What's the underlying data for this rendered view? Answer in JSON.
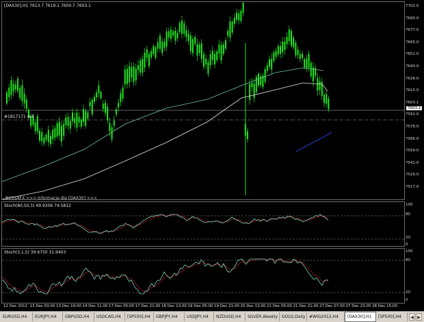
{
  "main": {
    "header": "[DAX30],H1  7613.7 7619.1 7600.7 7603.1",
    "price_ticks": [
      "7702.0",
      "7690.0",
      "7677.0",
      "7665.0",
      "7652.0",
      "7640.0",
      "7628.0",
      "7615.0",
      "7603.1",
      "7591.0",
      "7578.0",
      "7566.0",
      "7554.0",
      "7541.0",
      "7529.0",
      "7517.0"
    ],
    "current_price": "7603.1",
    "order_label": "#1817171 sell",
    "indicator_label": "BOSSAFX >>> Informacje dla [DAX30] <<<"
  },
  "stoch1": {
    "label": "Stoch(80,50,5) 49.9306 74.5812",
    "ticks": [
      "100",
      "80",
      "20",
      "0"
    ]
  },
  "stoch2": {
    "label": "Stoch(3,1,5) 39.6750 31.9403",
    "ticks": [
      "100",
      "80",
      "20",
      "0"
    ]
  },
  "time_labels": [
    "12 Dec 2012",
    "13 Dec 03:00",
    "13 Dec 19:00",
    "14 Dec 11:00",
    "17 Dec 05:00",
    "17 Dec 21:00",
    "18 Dec 13:00",
    "19 Dec 05:00",
    "19 Dec 21:00",
    "20 Dec 13:00",
    "21 Dec 05:00",
    "21 Dec 21:00",
    "27 Dec 07:00",
    "27 Dec 23:05",
    "28 Dec 15:00"
  ],
  "tabs": [
    {
      "label": "EURUSD,H4",
      "active": false
    },
    {
      "label": "EURJPY,H4",
      "active": false
    },
    {
      "label": "GBPUSD,H4",
      "active": false
    },
    {
      "label": "USDCAD,H4",
      "active": false
    },
    {
      "label": "[SP500],H4",
      "active": false
    },
    {
      "label": "GBPJPY,H4",
      "active": false
    },
    {
      "label": "USDJPY,H4",
      "active": false
    },
    {
      "label": "NZDUSD,H4",
      "active": false
    },
    {
      "label": "SILVER,Weekly",
      "active": false
    },
    {
      "label": "GOLD,Daily",
      "active": false
    },
    {
      "label": "#WIG2012,H4",
      "active": false
    },
    {
      "label": "[DAX30],H1",
      "active": true
    },
    {
      "label": "[SP500],H4",
      "active": false
    }
  ],
  "colors": {
    "candle": "#22e822",
    "sma_fast": "#6fc8a8",
    "sma_slow": "#e8e8e8",
    "ma_blue": "#2850ff",
    "stoch_main": "#7fd6c0",
    "stoch_signal": "#ff3030"
  },
  "icons": {
    "nav_left": "left-arrow-icon",
    "nav_right": "right-arrow-icon"
  }
}
